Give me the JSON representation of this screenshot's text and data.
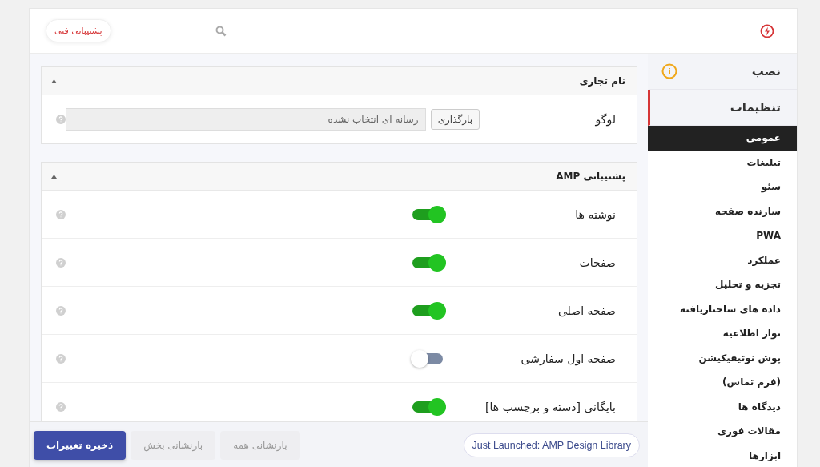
{
  "header": {
    "support_button": "پشتیبانی فنی"
  },
  "sidebar": {
    "sections": [
      {
        "label": "نصب",
        "kind": "alert",
        "selected": false
      },
      {
        "label": "تنظیمات",
        "kind": "plain",
        "selected": true
      }
    ],
    "items": [
      {
        "label": "عمومی",
        "selected": true
      },
      {
        "label": "تبلیغات",
        "selected": false
      },
      {
        "label": "سئو",
        "selected": false
      },
      {
        "label": "سازنده صفحه",
        "selected": false
      },
      {
        "label": "PWA",
        "selected": false
      },
      {
        "label": "عملکرد",
        "selected": false
      },
      {
        "label": "تجزیه و تحلیل",
        "selected": false
      },
      {
        "label": "داده های ساختاریافته",
        "selected": false
      },
      {
        "label": "نوار اطلاعیه",
        "selected": false
      },
      {
        "label": "پوش نوتیفیکیشن",
        "selected": false
      },
      {
        "label": "(فرم تماس)",
        "selected": false
      },
      {
        "label": "دیدگاه ها",
        "selected": false
      },
      {
        "label": "مقالات فوری",
        "selected": false
      },
      {
        "label": "ابزارها",
        "selected": false
      }
    ]
  },
  "panels": [
    {
      "title": "نام تجاری",
      "expanded": true,
      "rows": [
        {
          "kind": "media",
          "label": "لوگو",
          "button": "بارگذاری",
          "value": "رسانه ای انتخاب نشده"
        }
      ]
    },
    {
      "title": "پشتیبانی AMP",
      "expanded": true,
      "rows": [
        {
          "kind": "toggle",
          "label": "نوشته ها",
          "on": true
        },
        {
          "kind": "toggle",
          "label": "صفحات",
          "on": true
        },
        {
          "kind": "toggle",
          "label": "صفحه اصلی",
          "on": true
        },
        {
          "kind": "toggle",
          "label": "صفحه اول سفارشی",
          "on": false
        },
        {
          "kind": "toggle",
          "label": "بایگانی [دسته و برچسب ها]",
          "on": true
        }
      ]
    }
  ],
  "footer": {
    "save": "ذخیره تغییرات",
    "reset_section": "بازنشانی بخش",
    "reset_all": "بازنشانی همه",
    "announcement": "Just Launched: AMP Design Library"
  }
}
